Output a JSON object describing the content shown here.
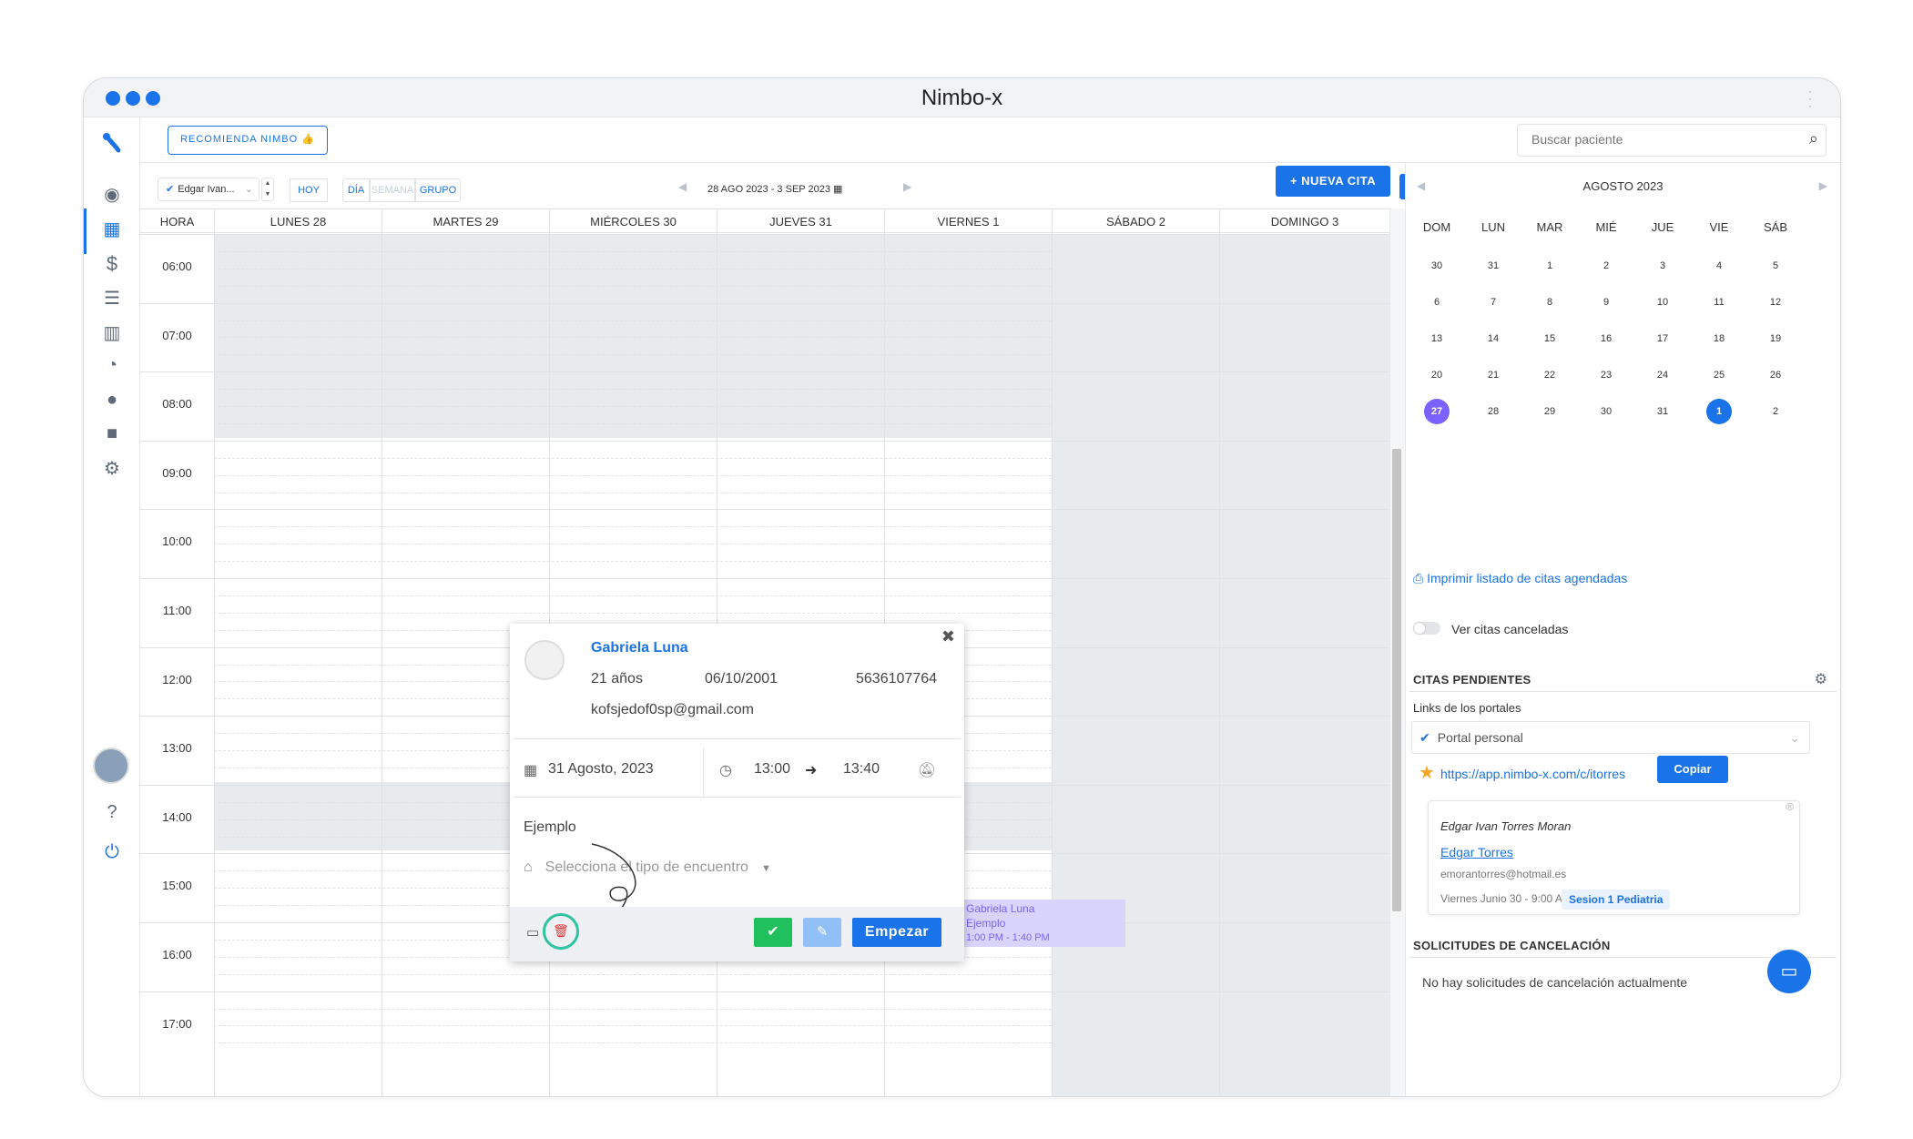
{
  "window": {
    "title": "Nimbo-x"
  },
  "topbar": {
    "recommend_label": "RECOMIENDA NIMBO 👍",
    "search_placeholder": "Buscar paciente"
  },
  "toolbar": {
    "doctor_select": "Edgar Ivan...",
    "today_label": "HOY",
    "views": [
      "DÍA",
      "SEMANA",
      "GRUPO"
    ],
    "date_range": "28 AGO 2023 - 3 SEP 2023",
    "new_appointment_label": "+ NUEVA CITA"
  },
  "calendar": {
    "hour_header": "HORA",
    "days": [
      "LUNES 28",
      "MARTES 29",
      "MIÉRCOLES 30",
      "JUEVES 31",
      "VIERNES 1",
      "SÁBADO 2",
      "DOMINGO 3"
    ],
    "hours": [
      "06:00",
      "07:00",
      "08:00",
      "09:00",
      "10:00",
      "11:00",
      "12:00",
      "13:00",
      "14:00",
      "15:00",
      "16:00",
      "17:00"
    ],
    "event": {
      "name": "Gabriela Luna",
      "title": "Ejemplo",
      "time": "1:00 PM - 1:40 PM"
    }
  },
  "popup": {
    "patient_name": "Gabriela Luna",
    "age": "21 años",
    "birthdate": "06/10/2001",
    "phone": "5636107764",
    "email": "kofsjedof0sp@gmail.com",
    "date": "31 Agosto, 2023",
    "start": "13:00",
    "end": "13:40",
    "note": "Ejemplo",
    "encounter_placeholder": "Selecciona el tipo de encuentro",
    "start_label": "Empezar"
  },
  "mini_calendar": {
    "title": "AGOSTO 2023",
    "weekdays": [
      "DOM",
      "LUN",
      "MAR",
      "MIÉ",
      "JUE",
      "VIE",
      "SÁB"
    ],
    "weeks": [
      [
        "30",
        "31",
        "1",
        "2",
        "3",
        "4",
        "5"
      ],
      [
        "6",
        "7",
        "8",
        "9",
        "10",
        "11",
        "12"
      ],
      [
        "13",
        "14",
        "15",
        "16",
        "17",
        "18",
        "19"
      ],
      [
        "20",
        "21",
        "22",
        "23",
        "24",
        "25",
        "26"
      ],
      [
        "27",
        "28",
        "29",
        "30",
        "31",
        "1",
        "2"
      ]
    ],
    "today_color": "#7b61ff",
    "selected_color": "#1a73e8"
  },
  "rpanel": {
    "print_label": "Imprimir listado de citas agendadas",
    "toggle_label": "Ver citas canceladas",
    "pending_title": "CITAS PENDIENTES",
    "links_label": "Links de los portales",
    "portal_option": "Portal personal",
    "portal_url": "https://app.nimbo-x.com/c/itorres",
    "copy_label": "Copiar",
    "card": {
      "doctor": "Edgar Ivan Torres Moran",
      "patient": "Edgar Torres",
      "email": "emorantorres@hotmail.es",
      "when": "Viernes Junio 30 - 9:00 AM",
      "session": "Sesion 1 Pediatria"
    },
    "cancel_title": "SOLICITUDES DE CANCELACIÓN",
    "cancel_empty": "No hay solicitudes de cancelación actualmente"
  },
  "colors": {
    "accent": "#1a73e8",
    "event": "#7b61ff",
    "success": "#20c05c",
    "highlight": "#2ec4a0"
  }
}
